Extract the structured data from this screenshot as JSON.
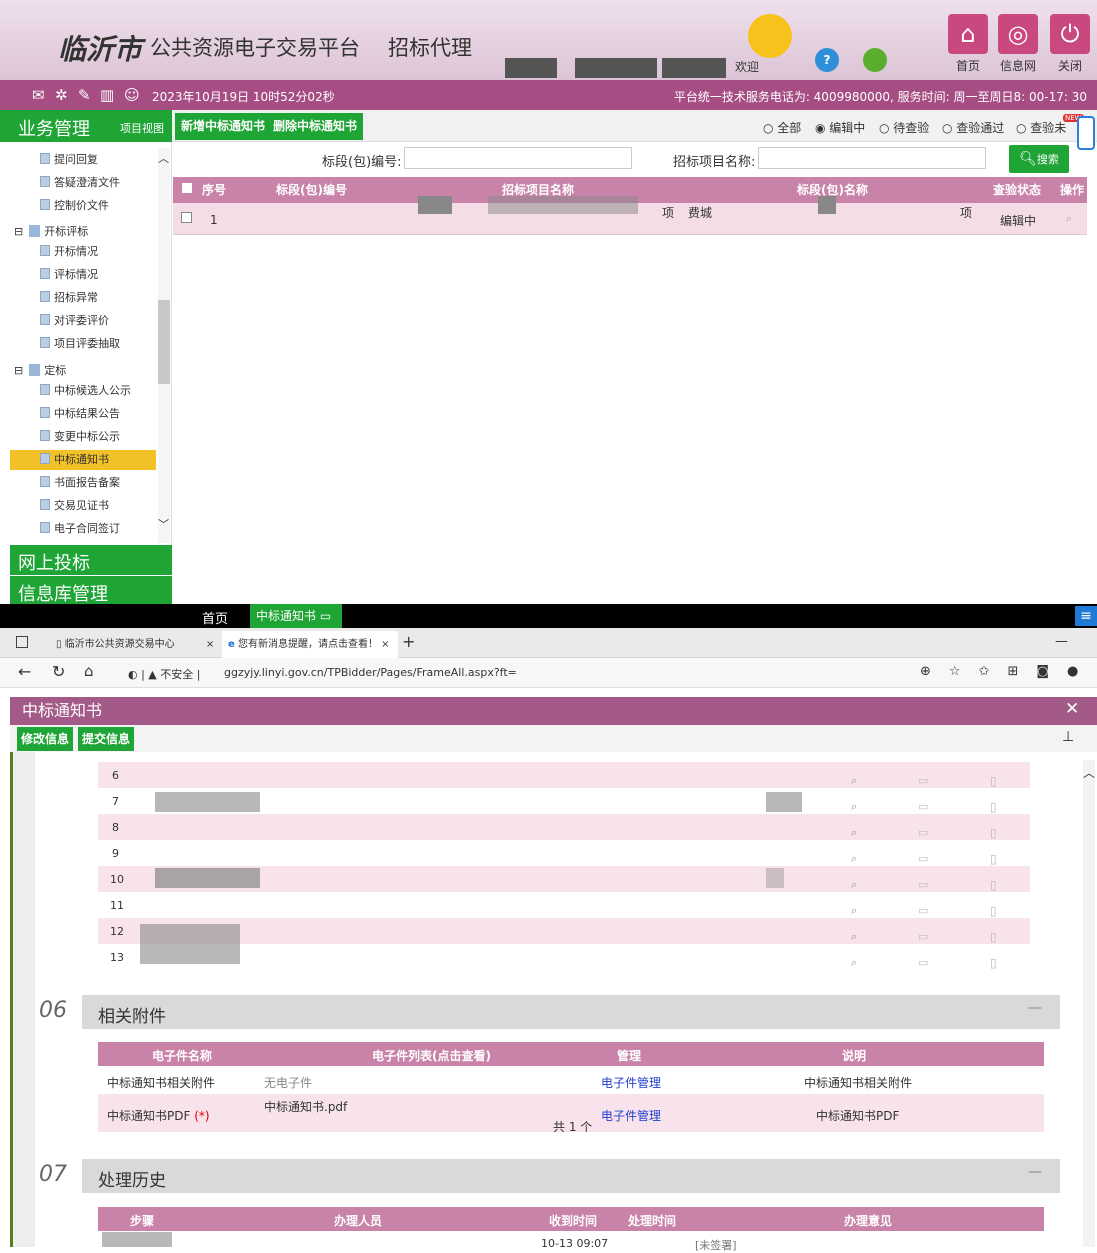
{
  "header": {
    "city": "临沂市",
    "platform": "公共资源电子交易平台",
    "role": "招标代理",
    "welcome": "欢迎",
    "btn_home": "首页",
    "btn_info": "信息网",
    "btn_close": "关闭"
  },
  "topbar": {
    "datetime": "2023年10月19日 10时52分02秒",
    "service": "平台统一技术服务电话为: 4009980000, 服务时间: 周一至周日8: 00-17: 30"
  },
  "toolbar": {
    "section": "业务管理",
    "view": "项目视图",
    "add": "新增中标通知书",
    "del": "删除中标通知书",
    "filters": [
      "全部",
      "编辑中",
      "待查验",
      "查验通过",
      "查验未"
    ],
    "active_filter": "编辑中",
    "new_badge": "NEW"
  },
  "sidebar": {
    "items": [
      "提问回复",
      "答疑澄清文件",
      "控制价文件"
    ],
    "group1": "开标评标",
    "items2": [
      "开标情况",
      "评标情况",
      "招标异常",
      "对评委评价",
      "项目评委抽取"
    ],
    "group2": "定标",
    "items3": [
      "中标候选人公示",
      "中标结果公告",
      "变更中标公示",
      "中标通知书",
      "书面报告备案",
      "交易见证书",
      "电子合同签订"
    ],
    "selected": "中标通知书",
    "nav_online": "网上投标",
    "nav_info": "信息库管理"
  },
  "filter": {
    "code_label": "标段(包)编号:",
    "name_label": "招标项目名称:",
    "search": "搜索",
    "search_en": "SEARCH"
  },
  "grid": {
    "headers": [
      "序号",
      "标段(包)编号",
      "招标项目名称",
      "标段(包)名称",
      "查验状态",
      "操作"
    ],
    "rows": [
      {
        "no": "1",
        "name_tail": "项",
        "sec_name": "费城",
        "sec_tail": "项",
        "status": "编辑中"
      }
    ]
  },
  "taskbar": {
    "home": "首页",
    "tab": "中标通知书"
  },
  "browser": {
    "tab1": "临沂市公共资源交易中心",
    "tab2": "您有新消息提醒，请点击查看！",
    "insecure": "不安全",
    "url": "ggzyjy.linyi.gov.cn/TPBidder/Pages/FrameAll.aspx?ft="
  },
  "dialog": {
    "title": "中标通知书",
    "btn_edit": "修改信息",
    "btn_submit": "提交信息",
    "list_rows": [
      "6",
      "7",
      "8",
      "9",
      "10",
      "11",
      "12",
      "13"
    ],
    "sec06": {
      "num": "06",
      "title": "相关附件",
      "headers": [
        "电子件名称",
        "电子件列表(点击查看)",
        "管理",
        "说明"
      ],
      "rows": [
        {
          "name": "中标通知书相关附件",
          "files": "无电子件",
          "manage": "电子件管理",
          "desc": "中标通知书相关附件"
        },
        {
          "name": "中标通知书PDF",
          "required": "(*)",
          "files": "中标通知书.pdf",
          "count": "共 1 个",
          "manage": "电子件管理",
          "desc": "中标通知书PDF"
        }
      ]
    },
    "sec07": {
      "num": "07",
      "title": "处理历史",
      "headers": [
        "步骤",
        "办理人员",
        "收到时间",
        "处理时间",
        "办理意见"
      ],
      "row": {
        "recv": "10-13 09:07",
        "opinion": "[未签署]"
      }
    }
  }
}
